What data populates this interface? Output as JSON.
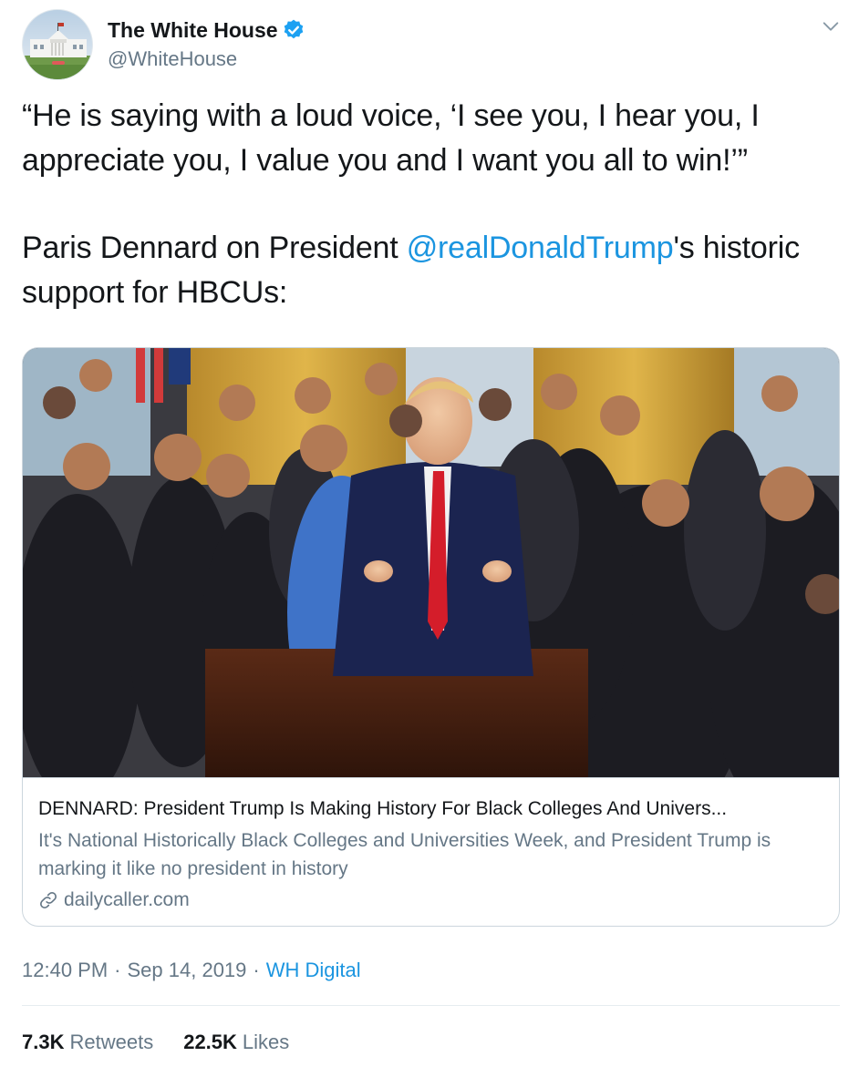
{
  "author": {
    "display_name": "The White House",
    "handle": "@WhiteHouse",
    "verified": true,
    "avatar": "white-house-building-photo"
  },
  "tweet": {
    "line1": "“He is saying with a loud voice, ‘I see you, I hear you, I appreciate you, I value you and I want you all to win!’”",
    "line2_prefix": "Paris Dennard on President ",
    "mention": "@realDonaldTrump",
    "line2_suffix": "'s historic support for HBCUs:"
  },
  "card": {
    "image": "photo-oval-office-group",
    "title": "DENNARD: President Trump Is Making History For Black Colleges And Univers...",
    "description": "It's National Historically Black Colleges and Universities Week, and President Trump is marking it like no president in history",
    "domain": "dailycaller.com",
    "domain_icon": "link-icon"
  },
  "meta": {
    "time": "12:40 PM",
    "separator": "·",
    "date": "Sep 14, 2019",
    "source": "WH Digital"
  },
  "stats": {
    "retweets_count": "7.3K",
    "retweets_label": "Retweets",
    "likes_count": "22.5K",
    "likes_label": "Likes"
  },
  "colors": {
    "text": "#14171a",
    "secondary": "#657786",
    "link": "#1b95e0",
    "verified": "#1da1f2",
    "border": "#ccd6dd"
  }
}
